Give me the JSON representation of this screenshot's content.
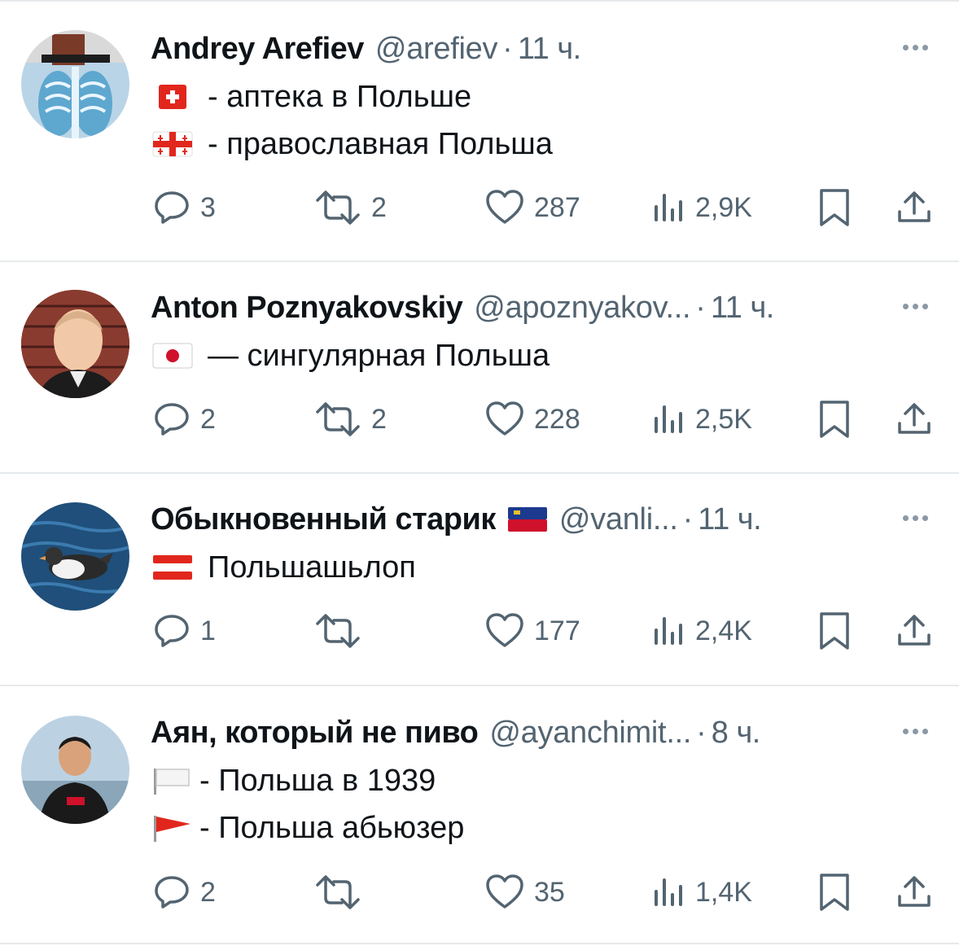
{
  "tweets": [
    {
      "name": "Andrey Arefiev",
      "handle": "@arefiev",
      "dot": "·",
      "time": "11 ч.",
      "lines": [
        {
          "flag": "switzerland-flag",
          "text": "- аптека в Польше"
        },
        {
          "flag": "georgia-flag",
          "text": "- православная Польша"
        }
      ],
      "replies": "3",
      "reposts": "2",
      "likes": "287",
      "views": "2,9K"
    },
    {
      "name": "Anton Poznyakovskiy",
      "handle": "@apoznyakov...",
      "dot": "·",
      "time": "11 ч.",
      "lines": [
        {
          "flag": "japan-flag",
          "text": "— сингулярная Польша"
        }
      ],
      "replies": "2",
      "reposts": "2",
      "likes": "228",
      "views": "2,5K"
    },
    {
      "name": "Обыкновенный старик",
      "name_flag": "liechtenstein-flag",
      "handle": "@vanli...",
      "dot": "·",
      "time": "11 ч.",
      "lines": [
        {
          "flag": "austria-flag",
          "text": "Польшашьлоп"
        }
      ],
      "replies": "1",
      "reposts": "",
      "likes": "177",
      "views": "2,4K"
    },
    {
      "name": "Аян, который не пиво",
      "handle": "@ayanchimit...",
      "dot": "·",
      "time": "8 ч.",
      "lines": [
        {
          "flag": "white-flag",
          "text": "- Польша в 1939"
        },
        {
          "flag": "red-triangular-flag",
          "text": "- Польша абьюзер"
        }
      ],
      "replies": "2",
      "reposts": "",
      "likes": "35",
      "views": "1,4K"
    }
  ],
  "colors": {
    "text": "#0f1419",
    "secondary": "#536471",
    "divider": "#e6e9ec"
  }
}
